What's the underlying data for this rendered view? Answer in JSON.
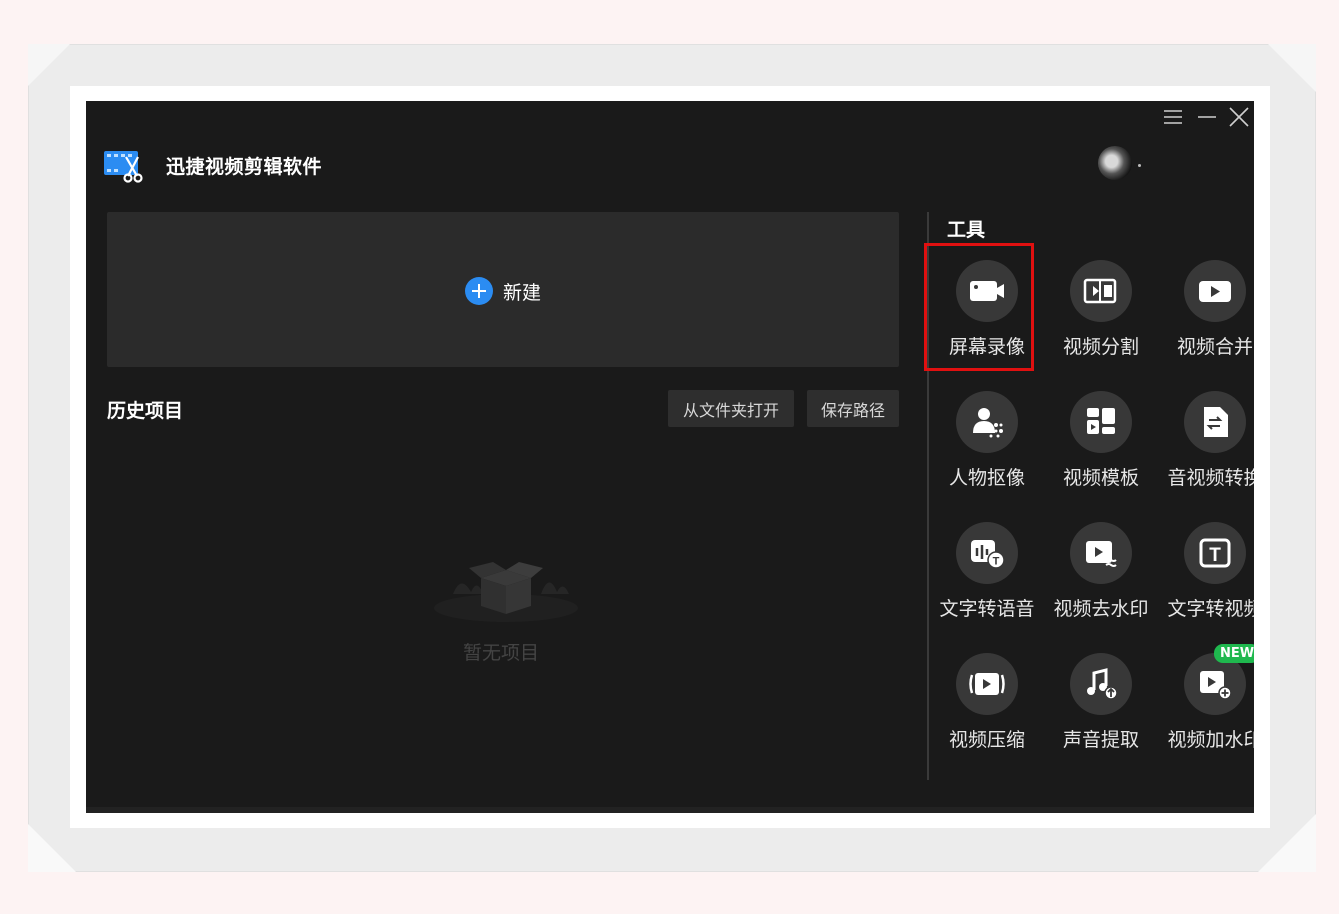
{
  "app": {
    "title": "迅捷视频剪辑软件"
  },
  "new_project": {
    "label": "新建"
  },
  "history": {
    "title": "历史项目",
    "open_folder_label": "从文件夹打开",
    "save_path_label": "保存路径",
    "empty_text": "暂无项目"
  },
  "tools": {
    "title": "工具",
    "items": [
      {
        "label": "屏幕录像",
        "icon": "screen-record-icon"
      },
      {
        "label": "视频分割",
        "icon": "video-split-icon"
      },
      {
        "label": "视频合并",
        "icon": "video-merge-icon"
      },
      {
        "label": "人物抠像",
        "icon": "person-cutout-icon"
      },
      {
        "label": "视频模板",
        "icon": "video-template-icon"
      },
      {
        "label": "音视频转换",
        "icon": "av-convert-icon"
      },
      {
        "label": "文字转语音",
        "icon": "text-to-speech-icon"
      },
      {
        "label": "视频去水印",
        "icon": "remove-watermark-icon"
      },
      {
        "label": "文字转视频",
        "icon": "text-to-video-icon"
      },
      {
        "label": "视频压缩",
        "icon": "video-compress-icon"
      },
      {
        "label": "声音提取",
        "icon": "audio-extract-icon"
      },
      {
        "label": "视频加水印",
        "icon": "add-watermark-icon"
      }
    ],
    "new_badge": "NEW"
  },
  "colors": {
    "accent": "#2b8cf2",
    "highlight": "#e01010",
    "badge": "#1fb84e",
    "background": "#1a1a1a"
  }
}
